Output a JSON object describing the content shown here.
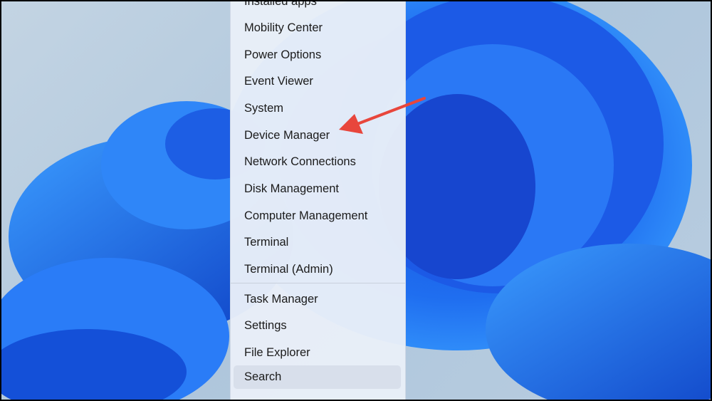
{
  "menu": {
    "items_top": [
      {
        "label": "Installed apps"
      },
      {
        "label": "Mobility Center"
      },
      {
        "label": "Power Options"
      },
      {
        "label": "Event Viewer"
      },
      {
        "label": "System"
      },
      {
        "label": "Device Manager"
      },
      {
        "label": "Network Connections"
      },
      {
        "label": "Disk Management"
      },
      {
        "label": "Computer Management"
      },
      {
        "label": "Terminal"
      },
      {
        "label": "Terminal (Admin)"
      }
    ],
    "items_bottom": [
      {
        "label": "Task Manager"
      },
      {
        "label": "Settings"
      },
      {
        "label": "File Explorer"
      },
      {
        "label": "Search"
      }
    ],
    "highlighted": "Search"
  },
  "annotation": {
    "arrow_color": "#e8463c",
    "points_to": "Device Manager"
  }
}
